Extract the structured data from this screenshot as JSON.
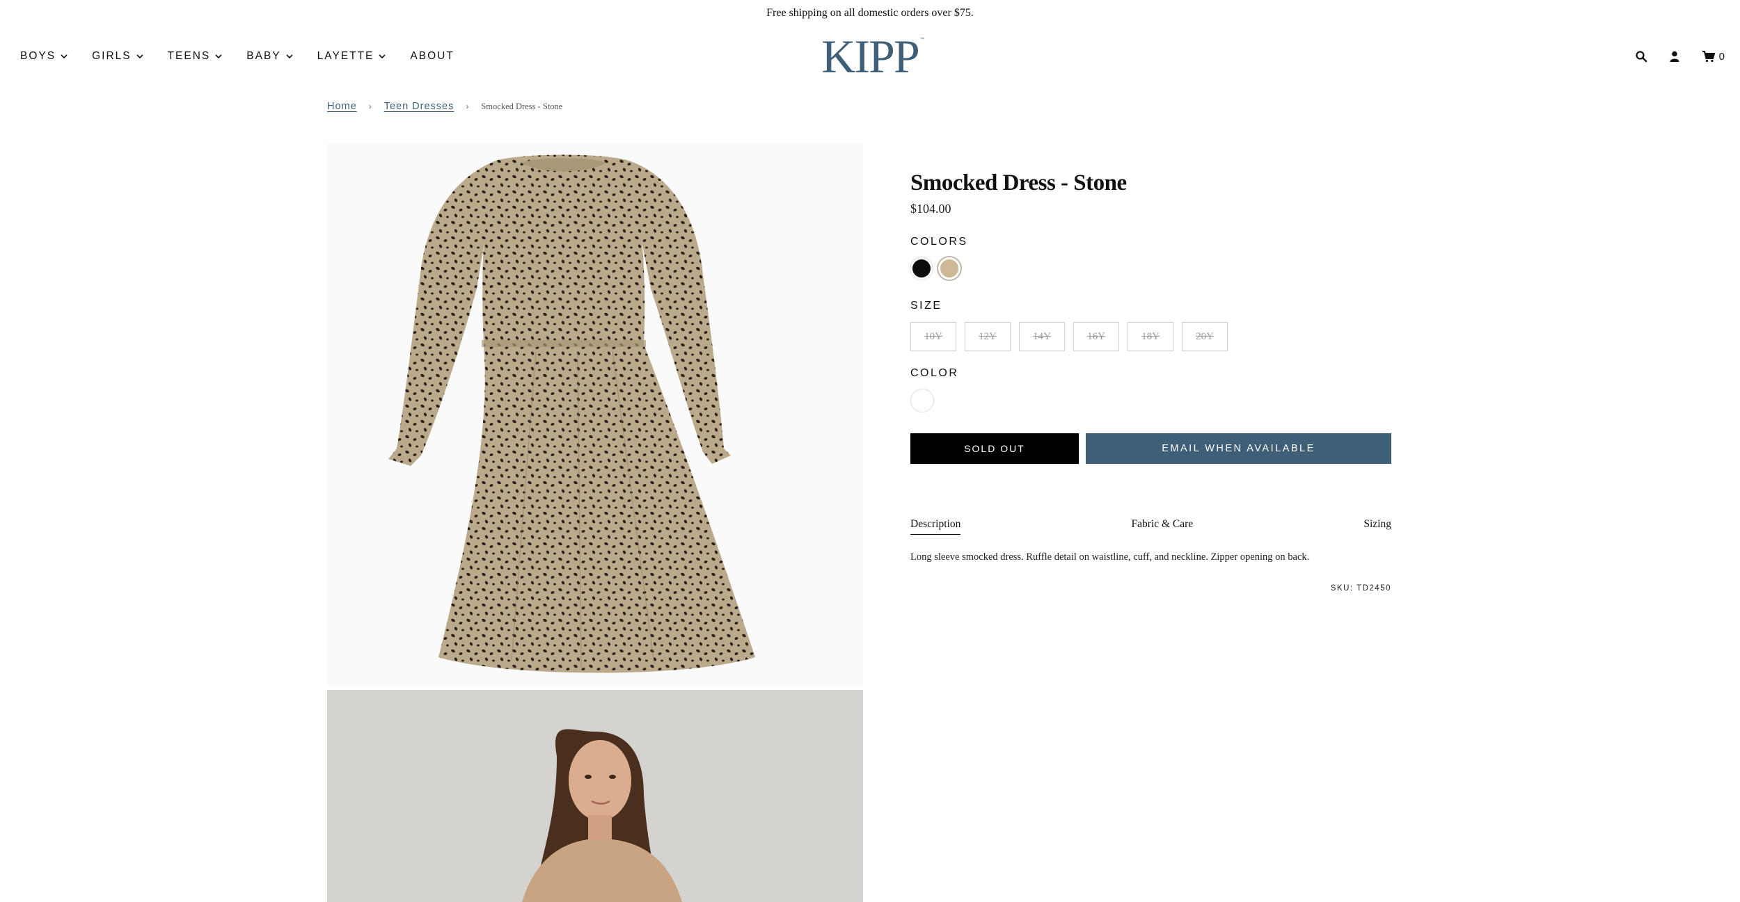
{
  "announcement": "Free shipping on all domestic orders over $75.",
  "nav": {
    "items": [
      {
        "label": "BOYS",
        "dropdown": true
      },
      {
        "label": "GIRLS",
        "dropdown": true
      },
      {
        "label": "TEENS",
        "dropdown": true
      },
      {
        "label": "BABY",
        "dropdown": true
      },
      {
        "label": "LAYETTE",
        "dropdown": true
      },
      {
        "label": "ABOUT",
        "dropdown": false
      }
    ],
    "logo_text": "KIPP",
    "cart_count": "0",
    "icons": [
      "search-icon",
      "account-icon",
      "cart-icon"
    ]
  },
  "breadcrumb": {
    "home": "Home",
    "category": "Teen Dresses",
    "current": "Smocked Dress - Stone"
  },
  "product": {
    "title": "Smocked Dress - Stone",
    "price": "$104.00",
    "colors_label": "COLORS",
    "size_label": "SIZE",
    "sizes": [
      "10Y",
      "12Y",
      "14Y",
      "16Y",
      "18Y",
      "20Y"
    ],
    "color_label": "COLOR",
    "sold_out_label": "SOLD OUT",
    "email_label": "EMAIL WHEN AVAILABLE",
    "tabs": [
      "Description",
      "Fabric & Care",
      "Sizing"
    ],
    "description": "Long sleeve smocked dress. Ruffle detail on waistline, cuff, and neckline. Zipper opening on back.",
    "sku": "SKU: TD2450"
  },
  "colors": {
    "brand": "#3e5f77",
    "swatch_black": "#0b0b0b",
    "swatch_stone": "#cdb996"
  }
}
